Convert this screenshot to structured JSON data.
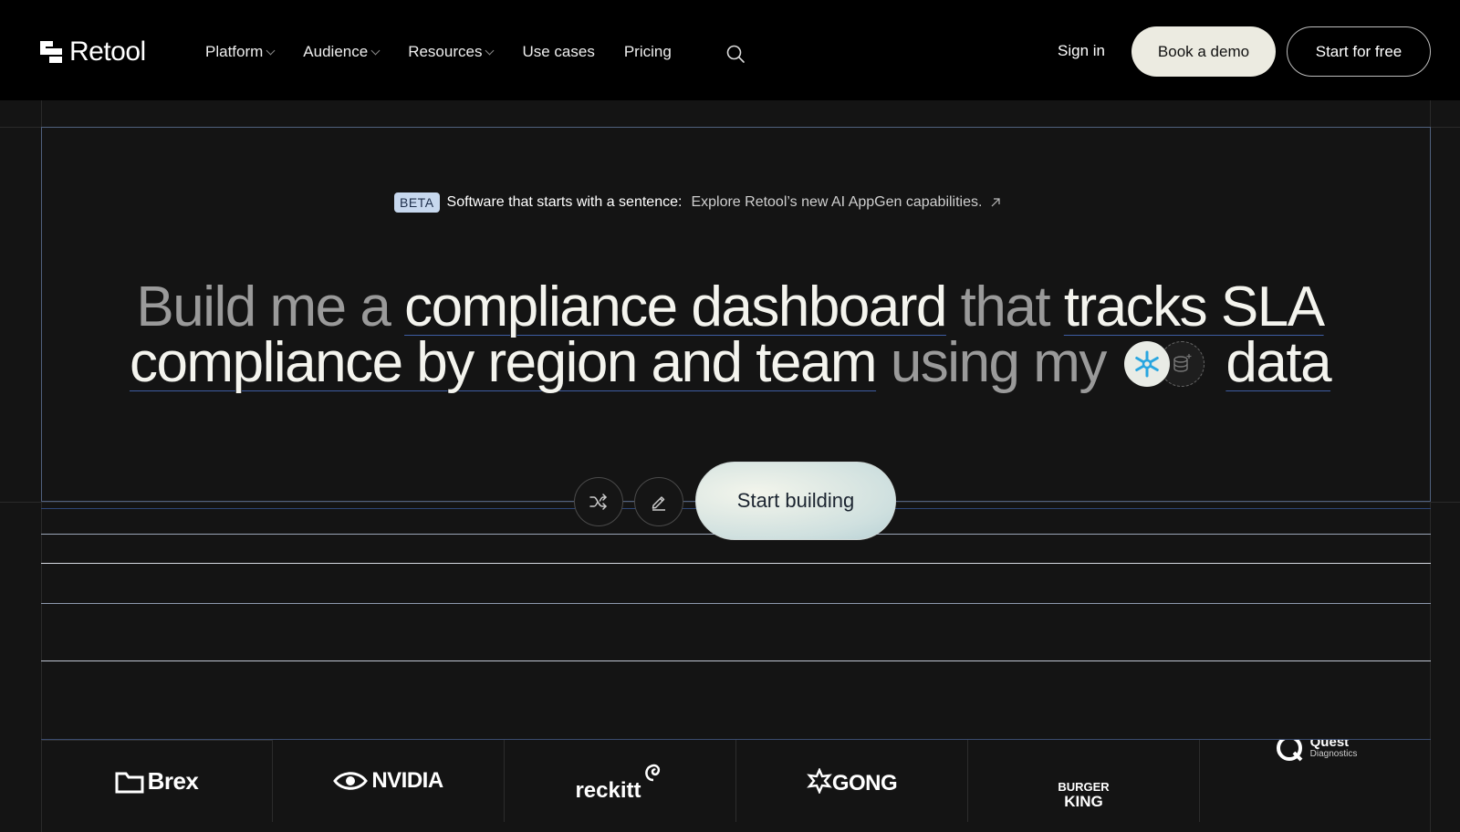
{
  "nav": {
    "brand": "Retool",
    "menu": [
      {
        "label": "Platform",
        "has_dropdown": true
      },
      {
        "label": "Audience",
        "has_dropdown": true
      },
      {
        "label": "Resources",
        "has_dropdown": true
      },
      {
        "label": "Use cases",
        "has_dropdown": false
      },
      {
        "label": "Pricing",
        "has_dropdown": false
      }
    ],
    "search_icon": "search-icon",
    "sign_in": "Sign in",
    "book_demo": "Book a demo",
    "start_free": "Start for free"
  },
  "banner": {
    "badge": "BETA",
    "text": "Software that starts with a sentence:",
    "link": "Explore Retool’s new AI AppGen capabilities."
  },
  "headline": {
    "w1": "Build me a",
    "w2": "compliance dashboard",
    "w3": "that",
    "w4": "tracks SLA",
    "w5": "compliance by region and team",
    "w6": "using my",
    "w7": "data"
  },
  "controls": {
    "shuffle_icon": "shuffle-icon",
    "edit_icon": "pencil-icon",
    "start_building": "Start building"
  },
  "customers": {
    "brex": "Brex",
    "nvidia": "NVIDIA",
    "reckitt": "reckitt",
    "gong": "GONG",
    "burger_king_top": "BURGER",
    "burger_king_bottom": "KING",
    "quest": "Quest",
    "quest_sub": "Diagnostics"
  },
  "colors": {
    "nav_bg": "#000000",
    "page_bg": "#141414",
    "accent_underline": "#3e5da2",
    "demo_button": "#ecebe1"
  }
}
